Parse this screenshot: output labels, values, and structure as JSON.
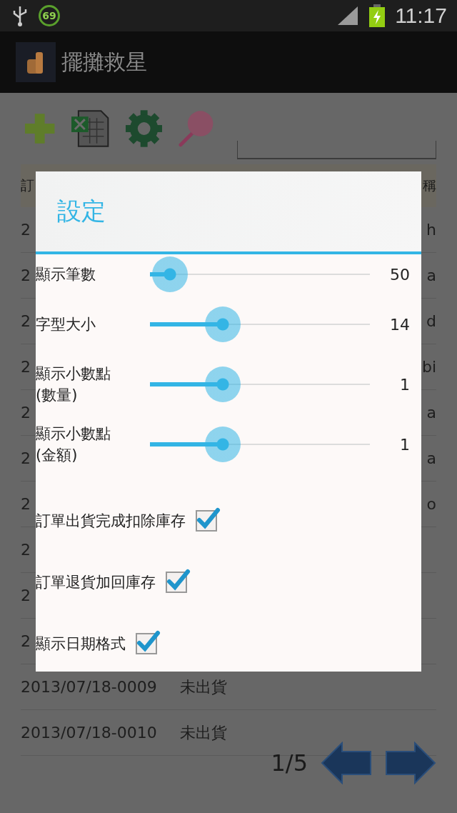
{
  "status_bar": {
    "badge": "69",
    "time": "11:17"
  },
  "app_bar": {
    "title": "擺攤救星"
  },
  "table": {
    "header": {
      "column_1": "訂",
      "column_3": "稱"
    },
    "rows": [
      {
        "column_1": "2",
        "column_3": "h"
      },
      {
        "column_1": "2",
        "column_3": "a"
      },
      {
        "column_1": "2",
        "column_3": "d"
      },
      {
        "column_1": "2",
        "column_3": "bi"
      },
      {
        "column_1": "2",
        "column_3": "a"
      },
      {
        "column_1": "2",
        "column_3": "a"
      },
      {
        "column_1": "2",
        "column_3": "o"
      },
      {
        "column_1": "2"
      },
      {
        "column_1": "2"
      },
      {
        "column_1": "2"
      },
      {
        "column_1": "2013/07/18-0009",
        "column_2": "未出貨"
      },
      {
        "column_1": "2013/07/18-0010",
        "column_2": "未出貨"
      }
    ]
  },
  "pagination": {
    "page": "1/5"
  },
  "dialog": {
    "title": "設定",
    "sliders": [
      {
        "label": "顯示筆數",
        "level": 0.09,
        "reading": "50"
      },
      {
        "label": "字型大小",
        "level": 0.33,
        "reading": "14"
      },
      {
        "label": "顯示小數點\n(數量)",
        "level": 0.33,
        "reading": "1"
      },
      {
        "label": "顯示小數點\n(金額)",
        "level": 0.33,
        "reading": "1"
      }
    ],
    "checkboxes": [
      {
        "label": "訂單出貨完成扣除庫存",
        "checked": true
      },
      {
        "label": "訂單退貨加回庫存",
        "checked": true
      },
      {
        "label": "顯示日期格式",
        "checked": true
      }
    ]
  }
}
